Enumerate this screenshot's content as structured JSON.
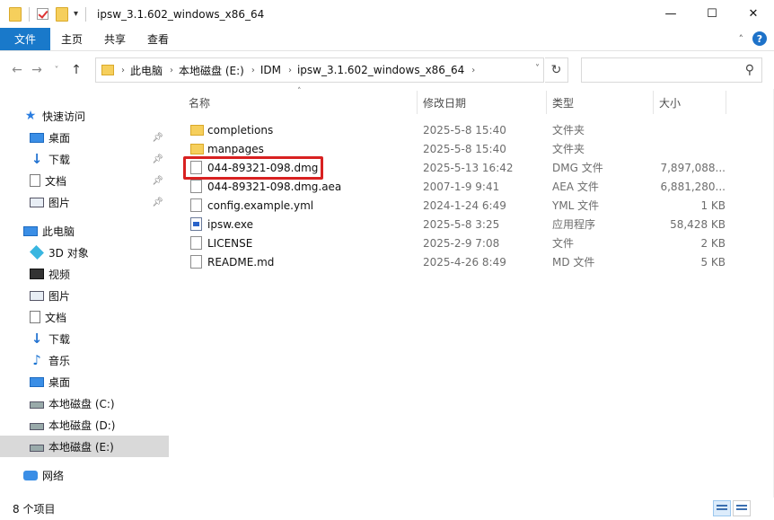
{
  "window": {
    "title": "ipsw_3.1.602_windows_x86_64",
    "controls": {
      "minimize": "—",
      "maximize": "☐",
      "close": "✕"
    }
  },
  "ribbon": {
    "tabs": [
      {
        "label": "文件",
        "active": true
      },
      {
        "label": "主页",
        "active": false
      },
      {
        "label": "共享",
        "active": false
      },
      {
        "label": "查看",
        "active": false
      }
    ],
    "collapse": "˄",
    "help": "?"
  },
  "nav": {
    "back": "←",
    "forward": "→",
    "recent": "˅",
    "up": "↑",
    "refresh": "↻"
  },
  "address": {
    "crumbs": [
      "此电脑",
      "本地磁盘 (E:)",
      "IDM",
      "ipsw_3.1.602_windows_x86_64"
    ],
    "separator": "›",
    "dropdown": "˅"
  },
  "search": {
    "placeholder": "",
    "icon": "search-icon"
  },
  "sidebar": {
    "quick_access": "快速访问",
    "quick_items": [
      "桌面",
      "下载",
      "文档",
      "图片"
    ],
    "this_pc": "此电脑",
    "pc_items": [
      "3D 对象",
      "视频",
      "图片",
      "文档",
      "下载",
      "音乐",
      "桌面",
      "本地磁盘 (C:)",
      "本地磁盘 (D:)",
      "本地磁盘 (E:)"
    ],
    "network": "网络",
    "selected": "本地磁盘 (E:)"
  },
  "columns": {
    "name": "名称",
    "date": "修改日期",
    "type": "类型",
    "size": "大小"
  },
  "files": [
    {
      "name": "completions",
      "date": "2025-5-8 15:40",
      "type": "文件夹",
      "size": "",
      "kind": "folder"
    },
    {
      "name": "manpages",
      "date": "2025-5-8 15:40",
      "type": "文件夹",
      "size": "",
      "kind": "folder"
    },
    {
      "name": "044-89321-098.dmg",
      "date": "2025-5-13 16:42",
      "type": "DMG 文件",
      "size": "7,897,088...",
      "kind": "file",
      "highlighted": true
    },
    {
      "name": "044-89321-098.dmg.aea",
      "date": "2007-1-9 9:41",
      "type": "AEA 文件",
      "size": "6,881,280...",
      "kind": "file"
    },
    {
      "name": "config.example.yml",
      "date": "2024-1-24 6:49",
      "type": "YML 文件",
      "size": "1 KB",
      "kind": "file"
    },
    {
      "name": "ipsw.exe",
      "date": "2025-5-8 3:25",
      "type": "应用程序",
      "size": "58,428 KB",
      "kind": "exe"
    },
    {
      "name": "LICENSE",
      "date": "2025-2-9 7:08",
      "type": "文件",
      "size": "2 KB",
      "kind": "file"
    },
    {
      "name": "README.md",
      "date": "2025-4-26 8:49",
      "type": "MD 文件",
      "size": "5 KB",
      "kind": "file"
    }
  ],
  "status": {
    "count": "8 个项目"
  },
  "colors": {
    "accent": "#1979ca",
    "highlight_box": "#d82121",
    "folder": "#f6cf5c"
  }
}
